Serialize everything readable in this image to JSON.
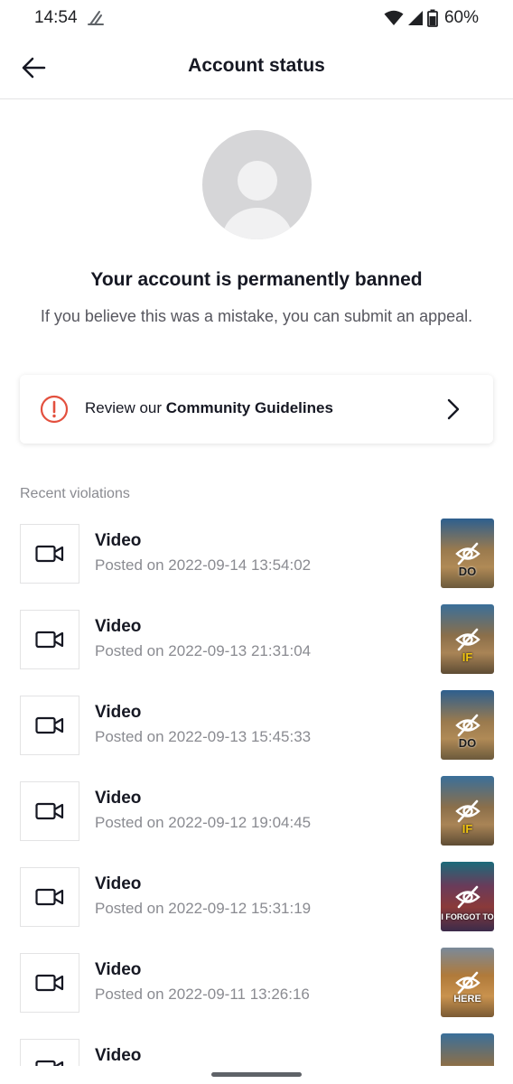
{
  "status_bar": {
    "time": "14:54",
    "battery": "60%"
  },
  "header": {
    "title": "Account status"
  },
  "ban": {
    "title": "Your account is permanently banned",
    "message": "If you believe this was a mistake, you can submit an appeal."
  },
  "guidelines_card": {
    "prefix": "Review our ",
    "link": "Community Guidelines"
  },
  "violations": {
    "label": "Recent violations",
    "items": [
      {
        "title": "Video",
        "date": "Posted on 2022-09-14 13:54:02",
        "caption": "DO"
      },
      {
        "title": "Video",
        "date": "Posted on 2022-09-13 21:31:04",
        "caption": "IF"
      },
      {
        "title": "Video",
        "date": "Posted on 2022-09-13 15:45:33",
        "caption": "DO"
      },
      {
        "title": "Video",
        "date": "Posted on 2022-09-12 19:04:45",
        "caption": "IF"
      },
      {
        "title": "Video",
        "date": "Posted on 2022-09-12 15:31:19",
        "caption": "I FORGOT TO"
      },
      {
        "title": "Video",
        "date": "Posted on 2022-09-11 13:26:16",
        "caption": "HERE"
      },
      {
        "title": "Video",
        "date": "",
        "caption": ""
      }
    ]
  },
  "colors": {
    "text": "#161823",
    "secondary": "#8a8b91",
    "warning": "#e3503e",
    "avatar": "#d6d6d8"
  },
  "icons": {
    "back": "arrow-left-icon",
    "warning": "exclamation-circle-icon",
    "chevron": "chevron-right-icon",
    "video": "video-camera-icon",
    "hidden": "eye-slash-icon"
  }
}
